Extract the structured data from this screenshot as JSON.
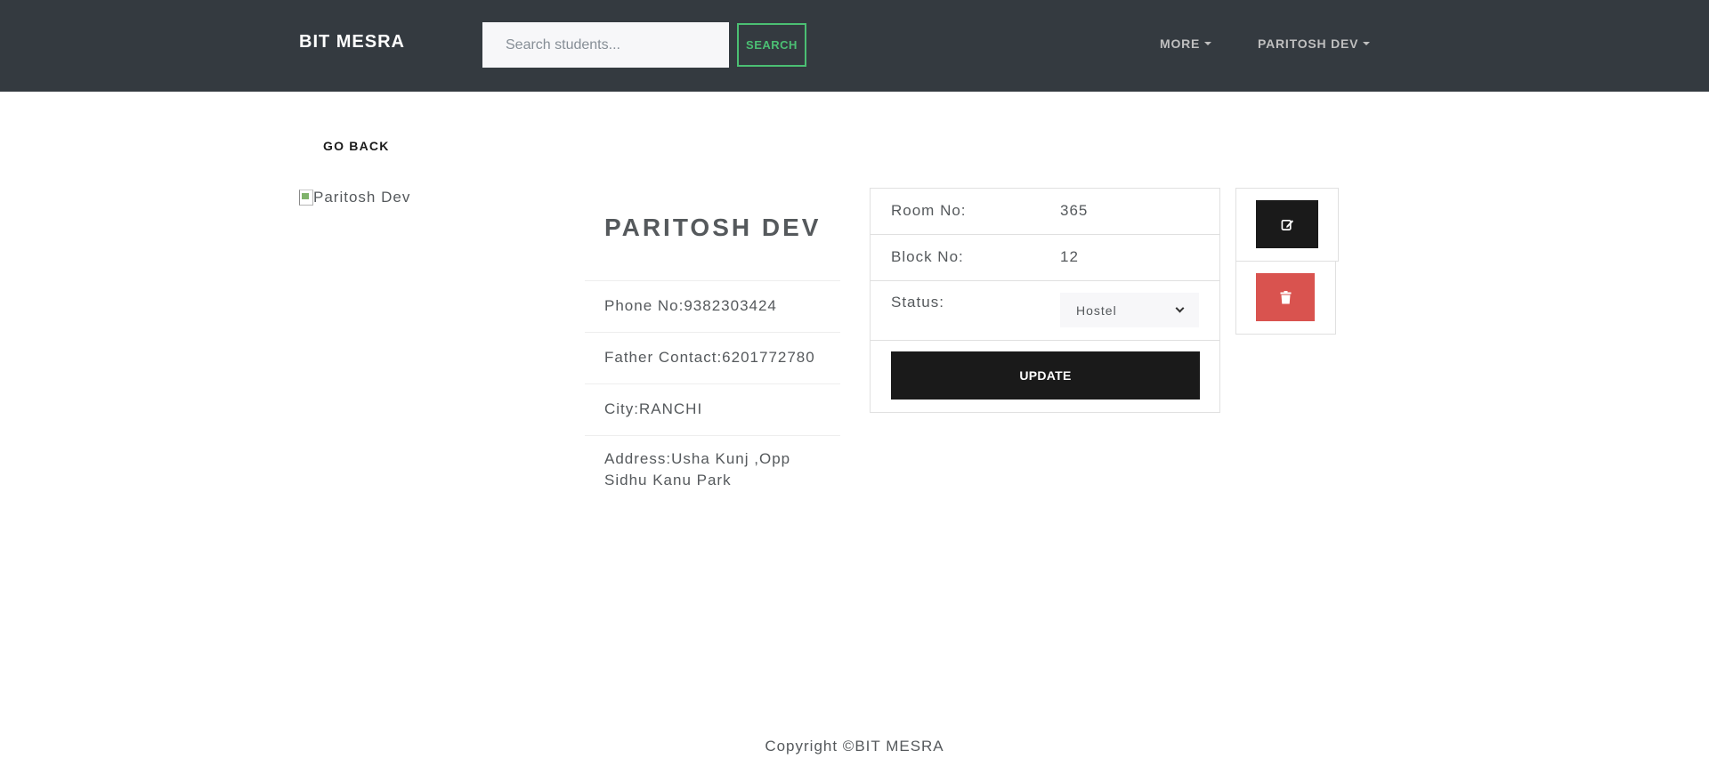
{
  "navbar": {
    "brand": "BIT MESRA",
    "search_placeholder": "Search students...",
    "search_label": "SEARCH",
    "more_label": "MORE",
    "user_label": "PARITOSH DEV"
  },
  "go_back_label": "GO BACK",
  "student": {
    "image_alt": "Paritosh Dev",
    "name": "PARITOSH DEV",
    "details": [
      "Phone No:9382303424",
      "Father Contact:6201772780",
      "City:RANCHI",
      "Address:Usha Kunj ,Opp Sidhu Kanu Park"
    ]
  },
  "room": {
    "room_label": "Room No:",
    "room_value": "365",
    "block_label": "Block No:",
    "block_value": "12",
    "status_label": "Status:",
    "status_value": "Hostel",
    "update_label": "UPDATE"
  },
  "actions": {
    "edit_icon": "edit-icon",
    "delete_icon": "trash-icon"
  },
  "footer": {
    "copyright": "Copyright ©BIT MESRA"
  },
  "colors": {
    "navbar_bg": "#343a40",
    "search_accent": "#4bbf73",
    "dark_button": "#1a1a1a",
    "danger_button": "#d9534f"
  }
}
